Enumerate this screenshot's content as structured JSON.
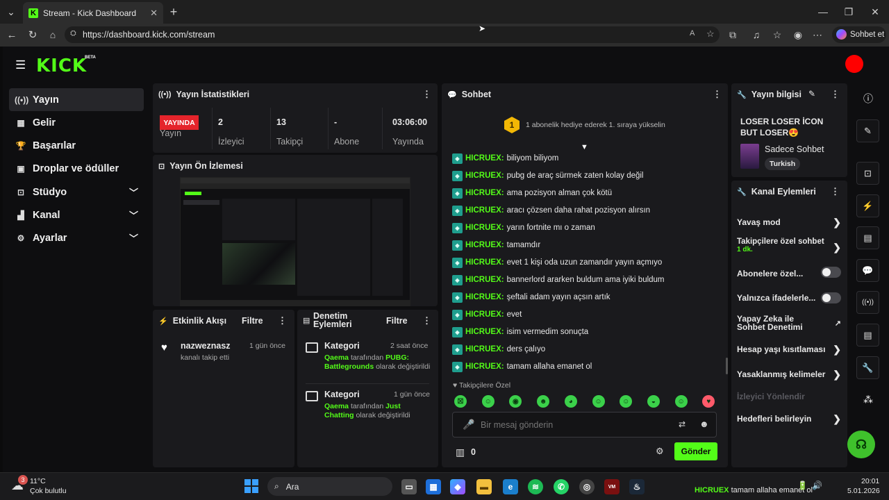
{
  "browser": {
    "tab_title": "Stream - Kick Dashboard",
    "url": "https://dashboard.kick.com/stream",
    "copilot_label": "Sohbet et"
  },
  "app": {
    "logo": "KICK",
    "logo_badge": "BETA"
  },
  "sidebar": {
    "items": [
      {
        "label": "Yayın",
        "icon": "broadcast-icon"
      },
      {
        "label": "Gelir",
        "icon": "revenue-icon"
      },
      {
        "label": "Başarılar",
        "icon": "trophy-icon"
      },
      {
        "label": "Droplar ve ödüller",
        "icon": "gift-icon"
      },
      {
        "label": "Stüdyo",
        "icon": "studio-icon"
      },
      {
        "label": "Kanal",
        "icon": "channel-icon"
      },
      {
        "label": "Ayarlar",
        "icon": "gear-icon"
      }
    ]
  },
  "stats": {
    "title": "Yayın İstatistikleri",
    "live_badge": "YAYINDA",
    "cells": [
      {
        "value": "",
        "label": "Yayın"
      },
      {
        "value": "2",
        "label": "İzleyici"
      },
      {
        "value": "13",
        "label": "Takipçi"
      },
      {
        "value": "-",
        "label": "Abone Sayısı"
      },
      {
        "value": "03:06:00",
        "label": "Yayında Olduğu"
      }
    ]
  },
  "preview": {
    "title": "Yayın Ön İzlemesi"
  },
  "activity": {
    "title": "Etkinlik Akışı",
    "filter": "Filtre",
    "items": [
      {
        "user": "nazweznasz",
        "text": "kanalı takip etti",
        "time": "1 gün önce"
      }
    ]
  },
  "moderation": {
    "title": "Denetim Eylemleri",
    "filter": "Filtre",
    "items": [
      {
        "title": "Kategori",
        "time": "2 saat önce",
        "actor": "Qaema",
        "mid": " tarafından ",
        "category": "PUBG: Battlegrounds",
        "end": " olarak değiştirildi"
      },
      {
        "title": "Kategori",
        "time": "1 gün önce",
        "actor": "Qaema",
        "mid": " tarafından ",
        "category": "Just Chatting",
        "end": " olarak değiştirildi"
      }
    ]
  },
  "chat": {
    "title": "Sohbet",
    "gift_num": "1",
    "gift_text": "1 abonelik hediye ederek 1. sıraya yükselin",
    "messages": [
      {
        "user": "HICRUEX:",
        "text": "biliyom biliyom"
      },
      {
        "user": "HICRUEX:",
        "text": "pubg de araç sürmek zaten kolay değil"
      },
      {
        "user": "HICRUEX:",
        "text": "ama pozisyon alman çok kötü"
      },
      {
        "user": "HICRUEX:",
        "text": "aracı çözsen daha rahat pozisyon alırsın"
      },
      {
        "user": "HICRUEX:",
        "text": "yarın fortnite mı o zaman"
      },
      {
        "user": "HICRUEX:",
        "text": "tamamdır"
      },
      {
        "user": "HICRUEX:",
        "text": "evet 1 kişi oda uzun zamandır yayın açmıyo"
      },
      {
        "user": "HICRUEX:",
        "text": "bannerlord ararken buldum ama iyiki buldum"
      },
      {
        "user": "HICRUEX:",
        "text": "şeftali adam yayın açsın artık"
      },
      {
        "user": "HICRUEX:",
        "text": "evet"
      },
      {
        "user": "HICRUEX:",
        "text": "isim vermedim sonuçta"
      },
      {
        "user": "HICRUEX:",
        "text": "ders çalıyo"
      },
      {
        "user": "HICRUEX:",
        "text": "tamam allaha emanet ol"
      }
    ],
    "followers_only": "Takipçilere Özel",
    "input_placeholder": "Bir mesaj gönderin",
    "points": "0",
    "send_label": "Gönder"
  },
  "stream_info": {
    "title": "Yayın bilgisi",
    "stream_title": "LOSER LOSER İCON BUT LOSER😍",
    "category": "Sadece Sohbet",
    "language": "Turkish"
  },
  "channel_actions": {
    "title": "Kanal Eylemleri",
    "items": [
      {
        "label": "Yavaş mod",
        "type": "chevron"
      },
      {
        "label": "Takipçilere özel sohbet",
        "sub": "1 dk.",
        "type": "chevron"
      },
      {
        "label": "Abonelere özel...",
        "type": "toggle",
        "on": false
      },
      {
        "label": "Yalnızca ifadelerle...",
        "type": "toggle",
        "on": false
      },
      {
        "label": "Yapay Zeka ile Sohbet Denetimi",
        "type": "external"
      },
      {
        "label": "Hesap yaşı kısıtlaması",
        "type": "chevron"
      },
      {
        "label": "Yasaklanmış kelimeler",
        "type": "chevron"
      },
      {
        "label": "İzleyici Yönlendir",
        "type": "disabled"
      },
      {
        "label": "Hedefleri belirleyin",
        "type": "chevron"
      }
    ]
  },
  "taskbar": {
    "weather_temp": "11°C",
    "weather_desc": "Çok bulutlu",
    "weather_badge": "3",
    "search_label": "Ara",
    "ticker_user": "HICRUEX",
    "ticker_text": "tamam allaha emanet ol",
    "time": "20:01",
    "date": "5.01.2026"
  },
  "colors": {
    "accent": "#53fc18",
    "live": "#e5242b",
    "panel": "#1a1a1d",
    "background": "#0e0e10"
  }
}
